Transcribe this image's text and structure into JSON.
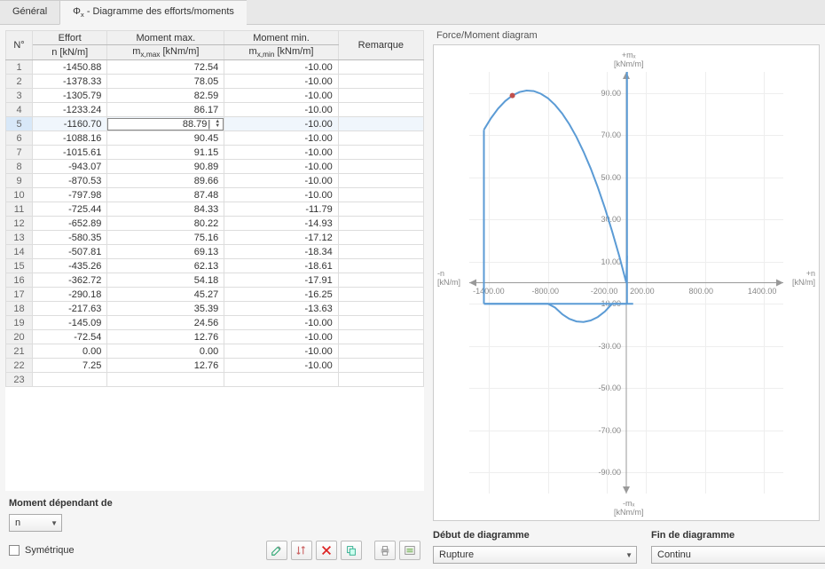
{
  "tabs": {
    "general": "Général",
    "diagram_prefix": "Φ",
    "diagram_sub": "x",
    "diagram_suffix": " - Diagramme des efforts/moments"
  },
  "table": {
    "headers": {
      "num": "N°",
      "effort_l1": "Effort",
      "effort_l2": "n [kN/m]",
      "mmax_prefix": "Moment max.",
      "mmax_sub": "x,max",
      "mmax_unit": " [kNm/m]",
      "mmin_prefix": "Moment min.",
      "mmin_sub": "x,min",
      "mmin_unit": " [kNm/m]",
      "remark": "Remarque"
    },
    "rows": [
      {
        "i": "1",
        "n": "-1450.88",
        "max": "72.54",
        "min": "-10.00",
        "r": ""
      },
      {
        "i": "2",
        "n": "-1378.33",
        "max": "78.05",
        "min": "-10.00",
        "r": ""
      },
      {
        "i": "3",
        "n": "-1305.79",
        "max": "82.59",
        "min": "-10.00",
        "r": ""
      },
      {
        "i": "4",
        "n": "-1233.24",
        "max": "86.17",
        "min": "-10.00",
        "r": ""
      },
      {
        "i": "5",
        "n": "-1160.70",
        "max": "88.79",
        "min": "-10.00",
        "r": "",
        "selected": true,
        "editing": true
      },
      {
        "i": "6",
        "n": "-1088.16",
        "max": "90.45",
        "min": "-10.00",
        "r": ""
      },
      {
        "i": "7",
        "n": "-1015.61",
        "max": "91.15",
        "min": "-10.00",
        "r": ""
      },
      {
        "i": "8",
        "n": "-943.07",
        "max": "90.89",
        "min": "-10.00",
        "r": ""
      },
      {
        "i": "9",
        "n": "-870.53",
        "max": "89.66",
        "min": "-10.00",
        "r": ""
      },
      {
        "i": "10",
        "n": "-797.98",
        "max": "87.48",
        "min": "-10.00",
        "r": ""
      },
      {
        "i": "11",
        "n": "-725.44",
        "max": "84.33",
        "min": "-11.79",
        "r": ""
      },
      {
        "i": "12",
        "n": "-652.89",
        "max": "80.22",
        "min": "-14.93",
        "r": ""
      },
      {
        "i": "13",
        "n": "-580.35",
        "max": "75.16",
        "min": "-17.12",
        "r": ""
      },
      {
        "i": "14",
        "n": "-507.81",
        "max": "69.13",
        "min": "-18.34",
        "r": ""
      },
      {
        "i": "15",
        "n": "-435.26",
        "max": "62.13",
        "min": "-18.61",
        "r": ""
      },
      {
        "i": "16",
        "n": "-362.72",
        "max": "54.18",
        "min": "-17.91",
        "r": ""
      },
      {
        "i": "17",
        "n": "-290.18",
        "max": "45.27",
        "min": "-16.25",
        "r": ""
      },
      {
        "i": "18",
        "n": "-217.63",
        "max": "35.39",
        "min": "-13.63",
        "r": ""
      },
      {
        "i": "19",
        "n": "-145.09",
        "max": "24.56",
        "min": "-10.00",
        "r": ""
      },
      {
        "i": "20",
        "n": "-72.54",
        "max": "12.76",
        "min": "-10.00",
        "r": ""
      },
      {
        "i": "21",
        "n": "0.00",
        "max": "0.00",
        "min": "-10.00",
        "r": ""
      },
      {
        "i": "22",
        "n": "7.25",
        "max": "12.76",
        "min": "-10.00",
        "r": ""
      },
      {
        "i": "23",
        "n": "",
        "max": "",
        "min": "",
        "r": ""
      }
    ]
  },
  "below": {
    "moment_depends": "Moment dépendant de",
    "moment_select": "n",
    "symmetric": "Symétrique"
  },
  "chart": {
    "title": "Force/Moment diagram",
    "y_top": "+mₓ",
    "y_unit": "[kNm/m]",
    "y_bot": "-mₓ",
    "x_left": "-n",
    "x_right": "+n",
    "x_unit": "[kN/m]"
  },
  "chart_data": {
    "type": "line",
    "xlabel": "n [kN/m]",
    "ylabel": "mₓ [kNm/m]",
    "x_range": [
      -1600,
      1600
    ],
    "y_range": [
      -100,
      100
    ],
    "x_ticks": [
      -1400,
      -800,
      -200,
      200,
      800,
      1400
    ],
    "y_ticks": [
      -90,
      -70,
      -50,
      -30,
      -10,
      10,
      30,
      50,
      70,
      90
    ],
    "highlight_point": {
      "x": -1160.7,
      "y": 88.79
    },
    "series": [
      {
        "name": "mx,max",
        "x": [
          -1450.88,
          -1378.33,
          -1305.79,
          -1233.24,
          -1160.7,
          -1088.16,
          -1015.61,
          -943.07,
          -870.53,
          -797.98,
          -725.44,
          -652.89,
          -580.35,
          -507.81,
          -435.26,
          -362.72,
          -290.18,
          -217.63,
          -145.09,
          -72.54,
          0.0,
          7.25
        ],
        "y": [
          72.54,
          78.05,
          82.59,
          86.17,
          88.79,
          90.45,
          91.15,
          90.89,
          89.66,
          87.48,
          84.33,
          80.22,
          75.16,
          69.13,
          62.13,
          54.18,
          45.27,
          35.39,
          24.56,
          12.76,
          0.0,
          12.76
        ]
      },
      {
        "name": "mx,min",
        "x": [
          -1450.88,
          -1378.33,
          -1305.79,
          -1233.24,
          -1160.7,
          -1088.16,
          -1015.61,
          -943.07,
          -870.53,
          -797.98,
          -725.44,
          -652.89,
          -580.35,
          -507.81,
          -435.26,
          -362.72,
          -290.18,
          -217.63,
          -145.09,
          -72.54,
          0.0,
          7.25
        ],
        "y": [
          -10.0,
          -10.0,
          -10.0,
          -10.0,
          -10.0,
          -10.0,
          -10.0,
          -10.0,
          -10.0,
          -10.0,
          -11.79,
          -14.93,
          -17.12,
          -18.34,
          -18.61,
          -17.91,
          -16.25,
          -13.63,
          -10.0,
          -10.0,
          -10.0,
          -10.0
        ]
      }
    ]
  },
  "bottom": {
    "start_label": "Début de diagramme",
    "start_value": "Rupture",
    "end_label": "Fin de diagramme",
    "end_value": "Continu"
  }
}
